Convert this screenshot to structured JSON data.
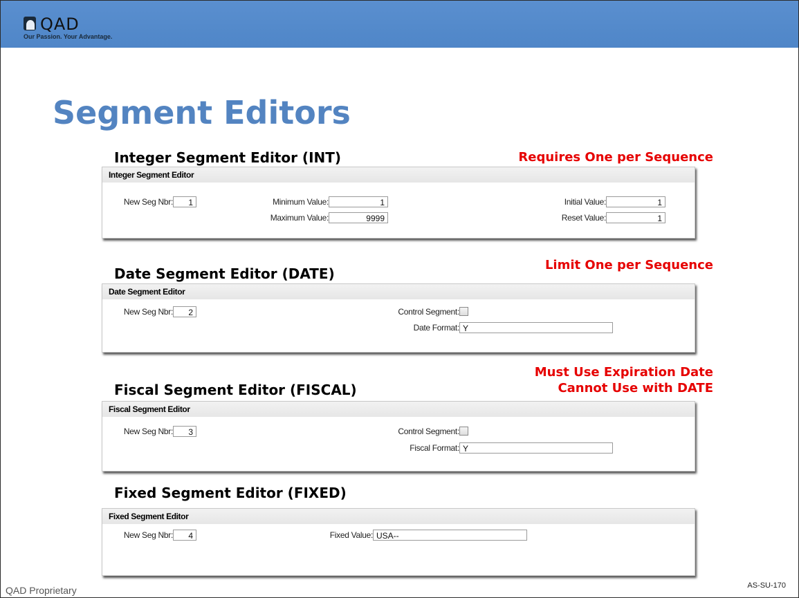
{
  "header": {
    "logo_text": "QAD",
    "logo_tagline": "Our Passion. Your Advantage."
  },
  "slide": {
    "title": "Segment Editors"
  },
  "sections": {
    "int": {
      "heading": "Integer Segment Editor (INT)",
      "note": "Requires One per Sequence",
      "panel_title": "Integer Segment Editor",
      "seg_label": "New Seg Nbr:",
      "seg_value": "1",
      "min_label": "Minimum Value:",
      "min_value": "1",
      "max_label": "Maximum Value:",
      "max_value": "9999",
      "initial_label": "Initial Value:",
      "initial_value": "1",
      "reset_label": "Reset Value:",
      "reset_value": "1"
    },
    "date": {
      "heading": "Date Segment Editor (DATE)",
      "note": "Limit One per Sequence",
      "panel_title": "Date Segment Editor",
      "seg_label": "New Seg Nbr:",
      "seg_value": "2",
      "control_label": "Control Segment:",
      "control_checked": false,
      "format_label": "Date Format:",
      "format_value": "Y"
    },
    "fiscal": {
      "heading": "Fiscal Segment Editor (FISCAL)",
      "note_line1": "Must Use Expiration Date",
      "note_line2": "Cannot Use with DATE",
      "panel_title": "Fiscal Segment Editor",
      "seg_label": "New Seg Nbr:",
      "seg_value": "3",
      "control_label": "Control Segment:",
      "control_checked": false,
      "format_label": "Fiscal Format:",
      "format_value": "Y"
    },
    "fixed": {
      "heading": "Fixed Segment Editor (FIXED)",
      "panel_title": "Fixed Segment Editor",
      "seg_label": "New Seg Nbr:",
      "seg_value": "4",
      "fixed_label": "Fixed Value:",
      "fixed_value": "USA--"
    }
  },
  "footer": {
    "left": "QAD Proprietary",
    "right": "AS-SU-170"
  },
  "colors": {
    "banner": "#5a8fcf",
    "title": "#5384c1",
    "note": "#e60000"
  }
}
